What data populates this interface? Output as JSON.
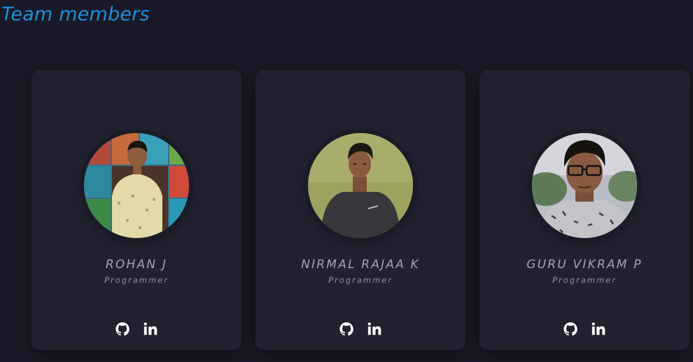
{
  "section": {
    "title": "Team members"
  },
  "members": [
    {
      "name": "ROHAN J",
      "role": "Programmer",
      "icons": [
        "github-icon",
        "linkedin-icon"
      ]
    },
    {
      "name": "NIRMAL RAJAA K",
      "role": "Programmer",
      "icons": [
        "github-icon",
        "linkedin-icon"
      ]
    },
    {
      "name": "GURU VIKRAM P",
      "role": "Programmer",
      "icons": [
        "github-icon",
        "linkedin-icon"
      ]
    }
  ],
  "colors": {
    "background": "#191927",
    "card": "#212130",
    "accent": "#1f8fd6",
    "name_text": "#a4a4b4",
    "icon": "#ffffff"
  }
}
